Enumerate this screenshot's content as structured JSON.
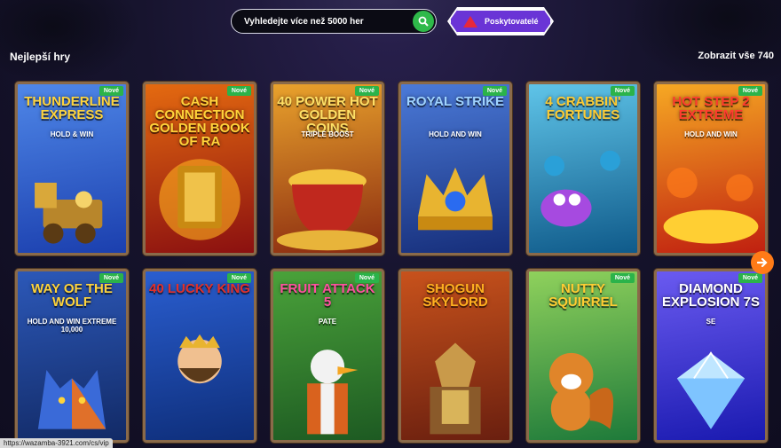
{
  "search": {
    "placeholder": "Vyhledejte více než 5000 her"
  },
  "providers": {
    "label": "Poskytovatelé"
  },
  "section": {
    "title": "Nejlepší hry",
    "show_all": "Zobrazit vše 740"
  },
  "new_badge": "Nové",
  "status_url": "https://wazamba-3921.com/cs/vip",
  "games": [
    {
      "title": "Thunderline Express",
      "subtitle": "Hold & Win",
      "colors": [
        "#1b3fae",
        "#4f87e8"
      ],
      "title_color": "#ffd43b",
      "icon": "train-icon",
      "new": true
    },
    {
      "title": "Cash Connection Golden Book of Ra",
      "subtitle": "",
      "colors": [
        "#8b1010",
        "#e46a10"
      ],
      "title_color": "#ffd43b",
      "icon": "book-icon",
      "new": true
    },
    {
      "title": "40 Power Hot Golden Coins",
      "subtitle": "Triple Boost",
      "colors": [
        "#8a2a10",
        "#e9a22c"
      ],
      "title_color": "#ffe066",
      "icon": "cauldron-icon",
      "new": true
    },
    {
      "title": "Royal Strike",
      "subtitle": "Hold and Win",
      "colors": [
        "#162e7a",
        "#4b7ad8"
      ],
      "title_color": "#9fd3ff",
      "icon": "crown-icon",
      "new": true
    },
    {
      "title": "4 Crabbin' Fortunes",
      "subtitle": "",
      "colors": [
        "#0f5a8a",
        "#5fc4e8"
      ],
      "title_color": "#ffcc33",
      "icon": "crab-icon",
      "new": true
    },
    {
      "title": "Hot Step 2 Extreme",
      "subtitle": "Hold and Win",
      "colors": [
        "#c02010",
        "#f6a823"
      ],
      "title_color": "#ff3b30",
      "icon": "fire-icon",
      "new": true
    },
    {
      "title": "Way of the Wolf",
      "subtitle": "Hold and Win Extreme 10,000",
      "colors": [
        "#122a66",
        "#2c58b8"
      ],
      "title_color": "#ffd43b",
      "icon": "wolf-icon",
      "new": true
    },
    {
      "title": "40 Lucky King",
      "subtitle": "",
      "colors": [
        "#0e2e7a",
        "#2a5ed0"
      ],
      "title_color": "#e2302a",
      "icon": "king-icon",
      "new": true
    },
    {
      "title": "Fruit Attack 5",
      "subtitle": "Pate",
      "colors": [
        "#1d5a22",
        "#4aa23a"
      ],
      "title_color": "#ff4fa0",
      "icon": "duck-icon",
      "new": true
    },
    {
      "title": "Shogun Skylord",
      "subtitle": "",
      "colors": [
        "#6a1f0f",
        "#c8521c"
      ],
      "title_color": "#ffb020",
      "icon": "warrior-icon",
      "new": false
    },
    {
      "title": "Nutty Squirrel",
      "subtitle": "",
      "colors": [
        "#1e7a3a",
        "#8fd15c"
      ],
      "title_color": "#ffcc33",
      "icon": "squirrel-icon",
      "new": true
    },
    {
      "title": "Diamond Explosion 7s",
      "subtitle": "SE",
      "colors": [
        "#1a1ab0",
        "#6a5af0"
      ],
      "title_color": "#ffffff",
      "icon": "diamond-icon",
      "new": true
    }
  ]
}
